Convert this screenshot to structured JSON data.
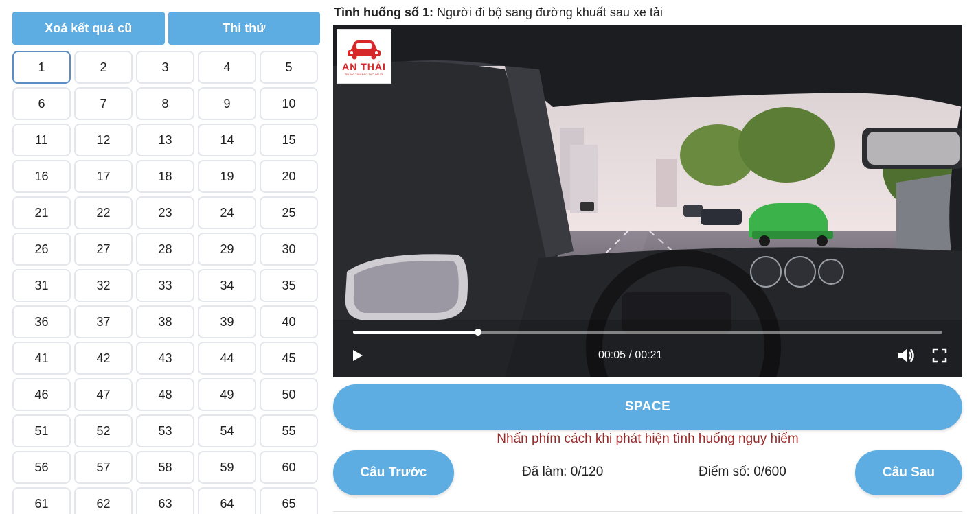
{
  "left_panel": {
    "clear_label": "Xoá kết quả cũ",
    "test_label": "Thi thử",
    "questions": [
      "1",
      "2",
      "3",
      "4",
      "5",
      "6",
      "7",
      "8",
      "9",
      "10",
      "11",
      "12",
      "13",
      "14",
      "15",
      "16",
      "17",
      "18",
      "19",
      "20",
      "21",
      "22",
      "23",
      "24",
      "25",
      "26",
      "27",
      "28",
      "29",
      "30",
      "31",
      "32",
      "33",
      "34",
      "35",
      "36",
      "37",
      "38",
      "39",
      "40",
      "41",
      "42",
      "43",
      "44",
      "45",
      "46",
      "47",
      "48",
      "49",
      "50",
      "51",
      "52",
      "53",
      "54",
      "55",
      "56",
      "57",
      "58",
      "59",
      "60",
      "61",
      "62",
      "63",
      "64",
      "65"
    ],
    "active_question": "1"
  },
  "situation": {
    "prefix": "Tình huống số 1:",
    "text": "Người đi bộ sang đường khuất sau xe tải"
  },
  "video": {
    "logo_brand": "AN THÁI",
    "logo_tagline": "TRUNG TÂM ĐÀO TẠO LÁI XE",
    "time": "00:05 / 00:21",
    "progress_fraction": 0.212
  },
  "controls": {
    "space_label": "SPACE",
    "hint": "Nhấn phím cách khi phát hiện tình huống nguy hiểm",
    "prev_label": "Câu Trước",
    "next_label": "Câu Sau",
    "done_text": "Đã làm: 0/120",
    "score_text": "Điểm số: 0/600"
  },
  "colors": {
    "accent": "#5dade2",
    "hint": "#9a2a2a",
    "active_border": "#5b8fc4",
    "logo_red": "#d62828"
  }
}
